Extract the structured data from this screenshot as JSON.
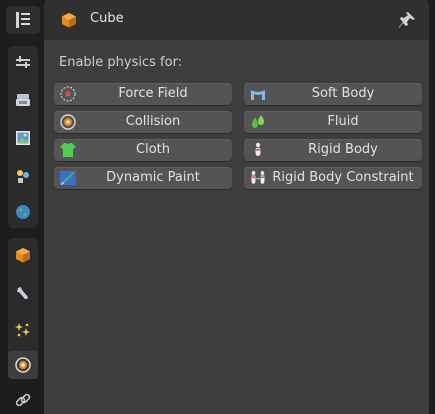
{
  "header": {
    "object_name": "Cube",
    "object_icon": "object-cube-icon",
    "pin_icon": "pin-icon"
  },
  "tabs": [
    {
      "name": "tool-tab",
      "icon": "tool-icon"
    },
    {
      "name": "render-tab",
      "icon": "render-icon"
    },
    {
      "name": "output-tab",
      "icon": "output-icon"
    },
    {
      "name": "view-layer-tab",
      "icon": "view-layer-icon"
    },
    {
      "name": "scene-tab",
      "icon": "scene-icon"
    },
    {
      "name": "world-tab",
      "icon": "world-icon"
    },
    {
      "name": "object-tab",
      "icon": "object-icon"
    },
    {
      "name": "modifiers-tab",
      "icon": "wrench-icon"
    },
    {
      "name": "particles-tab",
      "icon": "particles-icon"
    },
    {
      "name": "physics-tab",
      "icon": "physics-icon",
      "active": true
    },
    {
      "name": "constraints-tab",
      "icon": "constraint-icon"
    }
  ],
  "physics": {
    "section_label": "Enable physics for:",
    "buttons": [
      {
        "label": "Force Field",
        "icon": "force-field-icon"
      },
      {
        "label": "Soft Body",
        "icon": "soft-body-icon"
      },
      {
        "label": "Collision",
        "icon": "collision-icon"
      },
      {
        "label": "Fluid",
        "icon": "fluid-icon"
      },
      {
        "label": "Cloth",
        "icon": "cloth-icon"
      },
      {
        "label": "Rigid Body",
        "icon": "rigid-body-icon"
      },
      {
        "label": "Dynamic Paint",
        "icon": "dynamic-paint-icon"
      },
      {
        "label": "Rigid Body Constraint",
        "icon": "rigid-body-constraint-icon"
      }
    ]
  },
  "colors": {
    "panel_bg": "#3d3d3d",
    "button_bg": "#545454",
    "header_bg": "#303030",
    "outer_bg": "#1d1d1d",
    "object_orange": "#e8891c"
  }
}
